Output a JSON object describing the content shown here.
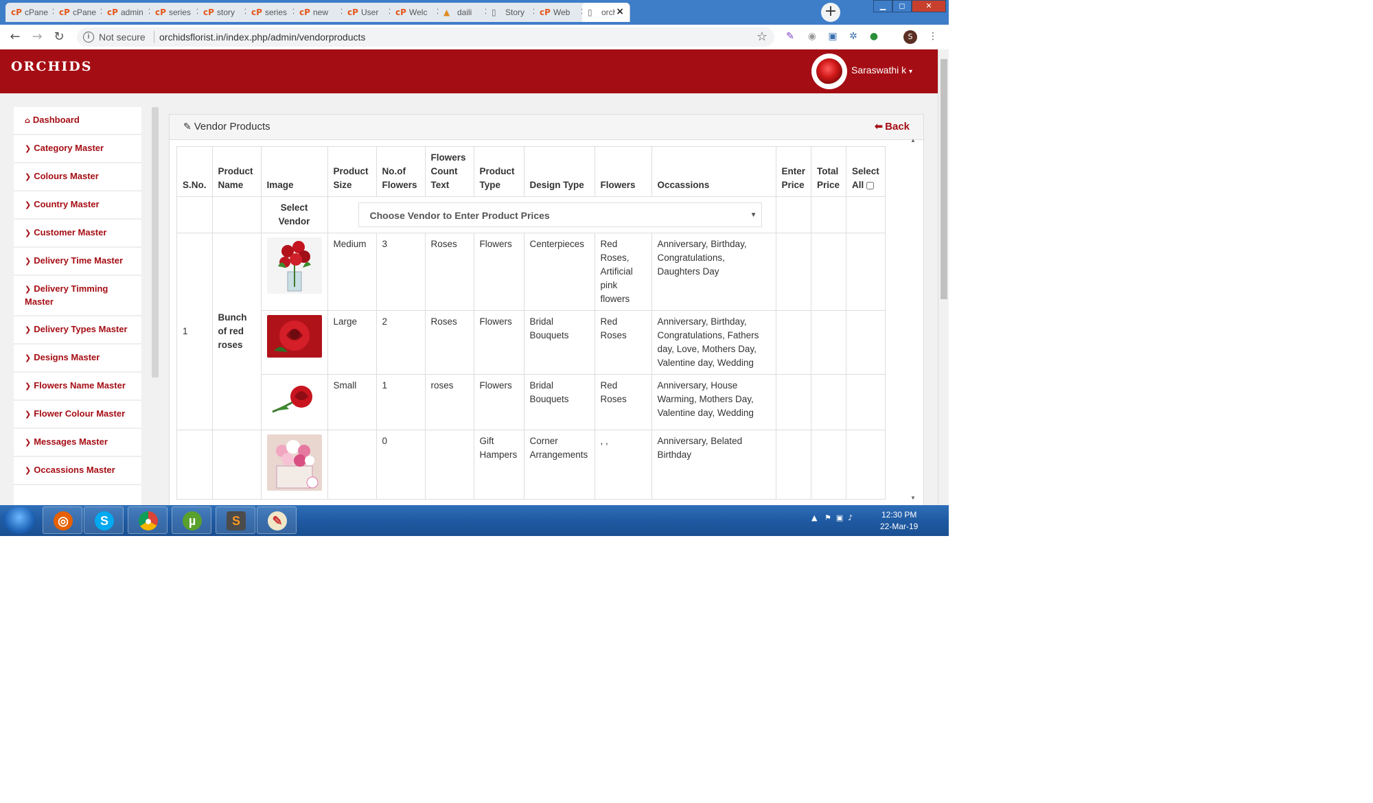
{
  "browser": {
    "tabs": [
      {
        "title": "cPanel",
        "icon": "cpanel-icon"
      },
      {
        "title": "cPanel",
        "icon": "cpanel-icon"
      },
      {
        "title": "admin",
        "icon": "cpanel-icon"
      },
      {
        "title": "series",
        "icon": "cpanel-icon"
      },
      {
        "title": "story",
        "icon": "cpanel-icon"
      },
      {
        "title": "series",
        "icon": "cpanel-icon"
      },
      {
        "title": "new",
        "icon": "cpanel-icon"
      },
      {
        "title": "User",
        "icon": "cpanel-icon"
      },
      {
        "title": "Welc",
        "icon": "cpanel-icon"
      },
      {
        "title": "daili",
        "icon": "dailyhunt-icon"
      },
      {
        "title": "Story",
        "icon": "page-icon"
      },
      {
        "title": "Web",
        "icon": "cpanel-icon"
      },
      {
        "title": "orch",
        "icon": "page-icon"
      }
    ],
    "security_label": "Not secure",
    "url": "orchidsflorist.in/index.php/admin/vendorproducts",
    "profile_initial": "S"
  },
  "app": {
    "brand": "ORCHIDS",
    "user_name": "Saraswathi k",
    "accent_color": "#a50d14"
  },
  "sidebar": {
    "items": [
      {
        "label": "Dashboard",
        "icon": "home-icon"
      },
      {
        "label": "Category Master",
        "icon": "chevron-right-icon"
      },
      {
        "label": "Colours Master",
        "icon": "chevron-right-icon"
      },
      {
        "label": "Country Master",
        "icon": "chevron-right-icon"
      },
      {
        "label": "Customer Master",
        "icon": "chevron-right-icon"
      },
      {
        "label": "Delivery Time Master",
        "icon": "chevron-right-icon"
      },
      {
        "label": "Delivery Timming Master",
        "icon": "chevron-right-icon"
      },
      {
        "label": "Delivery Types Master",
        "icon": "chevron-right-icon"
      },
      {
        "label": "Designs Master",
        "icon": "chevron-right-icon"
      },
      {
        "label": "Flowers Name Master",
        "icon": "chevron-right-icon"
      },
      {
        "label": "Flower Colour Master",
        "icon": "chevron-right-icon"
      },
      {
        "label": "Messages Master",
        "icon": "chevron-right-icon"
      },
      {
        "label": "Occassions Master",
        "icon": "chevron-right-icon"
      }
    ]
  },
  "panel": {
    "title": "Vendor Products",
    "back_label": "Back",
    "columns": {
      "sno": "S.No.",
      "product_name": "Product Name",
      "image": "Image",
      "product_size": "Product Size",
      "no_of_flowers": "No.of Flowers",
      "flowers_count_text": "Flowers Count Text",
      "product_type": "Product Type",
      "design_type": "Design Type",
      "flowers": "Flowers",
      "occassions": "Occassions",
      "enter_price": "Enter Price",
      "total_price": "Total Price",
      "select_all": "Select All"
    },
    "vendor_label": "Select Vendor",
    "vendor_placeholder": "Choose Vendor to Enter Product Prices",
    "products": [
      {
        "sno": "1",
        "name": "Bunch of red roses",
        "variants": [
          {
            "image": "red-roses-vase-image",
            "size": "Medium",
            "no_of_flowers": "3",
            "count_text": "Roses",
            "type": "Flowers",
            "design": "Centerpieces",
            "flowers": "Red Roses, Artificial pink flowers",
            "occassions": "Anniversary, Birthday, Congratulations, Daughters Day"
          },
          {
            "image": "red-rose-closeup-image",
            "size": "Large",
            "no_of_flowers": "2",
            "count_text": "Roses",
            "type": "Flowers",
            "design": "Bridal Bouquets",
            "flowers": "Red Roses",
            "occassions": "Anniversary, Birthday, Congratulations, Fathers day, Love, Mothers Day, Valentine day, Wedding"
          },
          {
            "image": "single-red-rose-image",
            "size": "Small",
            "no_of_flowers": "1",
            "count_text": "roses",
            "type": "Flowers",
            "design": "Bridal Bouquets",
            "flowers": "Red Roses",
            "occassions": "Anniversary, House Warming, Mothers Day, Valentine day, Wedding"
          }
        ]
      },
      {
        "sno": "",
        "name": "",
        "variants": [
          {
            "image": "pink-flower-hamper-image",
            "size": "",
            "no_of_flowers": "0",
            "count_text": "",
            "type": "Gift Hampers",
            "design": "Corner Arrangements",
            "flowers": ", ,",
            "occassions": "Anniversary, Belated Birthday"
          }
        ]
      }
    ]
  },
  "taskbar": {
    "time": "12:30 PM",
    "date": "22-Mar-19",
    "apps": [
      "firefox-icon",
      "skype-icon",
      "chrome-icon",
      "utorrent-icon",
      "sublime-icon",
      "paint-icon"
    ]
  }
}
